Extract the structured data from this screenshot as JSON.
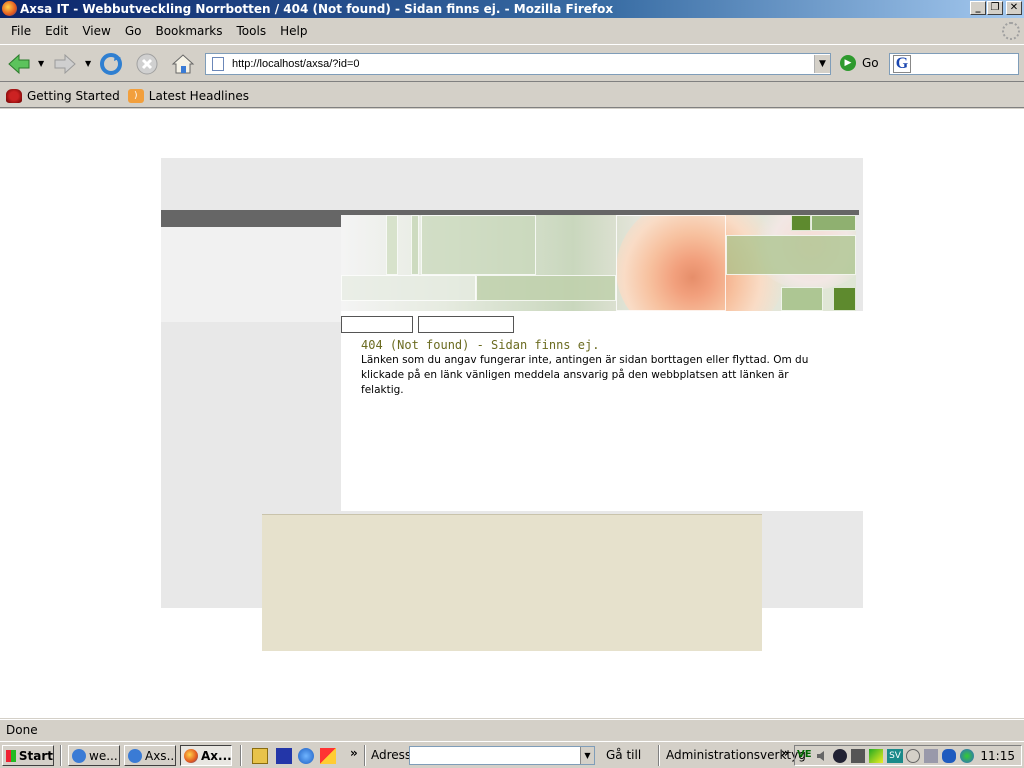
{
  "window": {
    "title": "Axsa IT - Webbutveckling Norrbotten / 404 (Not found) - Sidan finns ej. - Mozilla Firefox",
    "minimize_glyph": "_",
    "maximize_glyph": "❐",
    "close_glyph": "✕"
  },
  "menu": {
    "items": [
      "File",
      "Edit",
      "View",
      "Go",
      "Bookmarks",
      "Tools",
      "Help"
    ]
  },
  "navbar": {
    "url": "http://localhost/axsa/?id=0",
    "go_label": "Go",
    "search_engine_glyph": "G"
  },
  "bookmarks": {
    "items": [
      "Getting Started",
      "Latest Headlines"
    ]
  },
  "page": {
    "error_title": "404 (Not found) - Sidan finns ej.",
    "error_text": "Länken som du angav fungerar inte, antingen är sidan borttagen eller flyttad. Om du klickade på en länk vänligen meddela ansvarig på den webbplatsen att länken är felaktig."
  },
  "status": {
    "text": "Done"
  },
  "taskbar": {
    "start_label": "Start",
    "tasks": [
      "we...",
      "Axs...",
      "Ax..."
    ],
    "address_label": "Adress",
    "go_to_label": "Gå till",
    "admin_tools_label": "Administrationsverktyg",
    "overflow_glyph": "»",
    "tray_lang": "SV",
    "tray_ve": "VE",
    "clock": "11:15"
  },
  "colors": {
    "error_title": "#6b6b20",
    "footer_box": "#e6e1cc"
  }
}
